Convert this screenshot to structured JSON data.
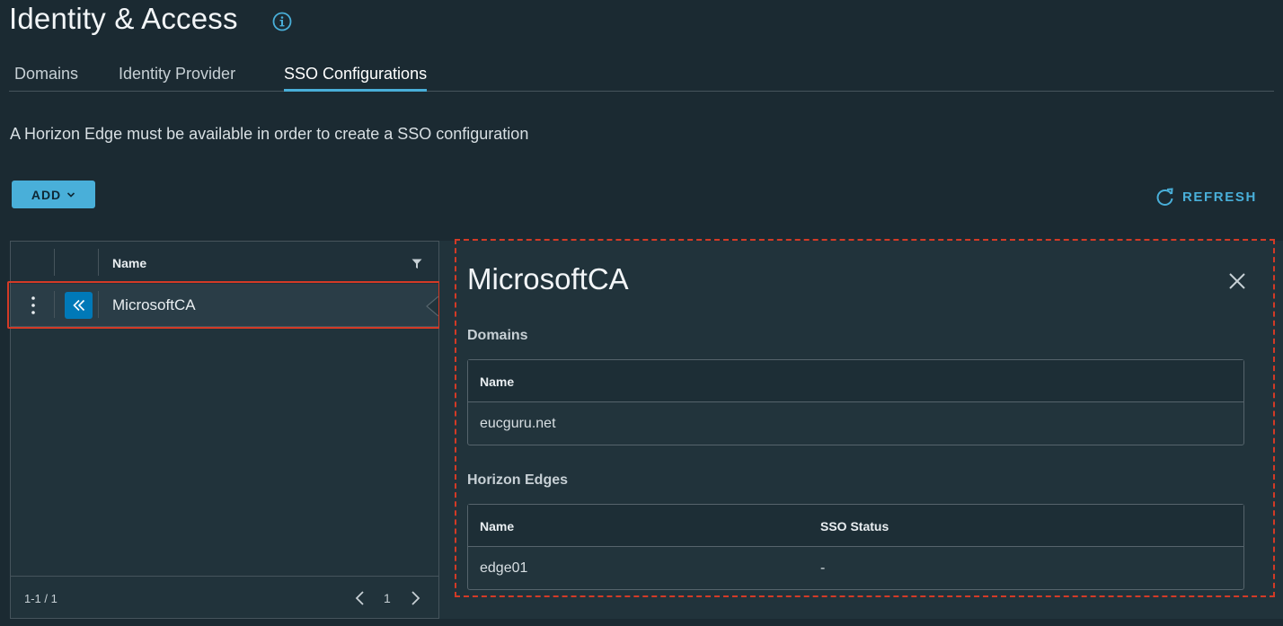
{
  "header": {
    "title": "Identity & Access",
    "info_icon": "info-circle-icon"
  },
  "tabs": [
    {
      "label": "Domains",
      "active": false
    },
    {
      "label": "Identity Provider",
      "active": false
    },
    {
      "label": "SSO Configurations",
      "active": true
    }
  ],
  "notice": "A Horizon Edge must be available in order to create a SSO configuration",
  "toolbar": {
    "add_label": "ADD",
    "refresh_label": "REFRESH"
  },
  "grid": {
    "column_header": "Name",
    "rows": [
      {
        "name": "MicrosoftCA",
        "selected": true
      }
    ],
    "footer": {
      "count": "1-1 / 1",
      "page": "1"
    }
  },
  "detail": {
    "title": "MicrosoftCA",
    "domains": {
      "heading": "Domains",
      "columns": [
        "Name"
      ],
      "rows": [
        [
          "eucguru.net"
        ]
      ]
    },
    "horizon_edges": {
      "heading": "Horizon Edges",
      "columns": [
        "Name",
        "SSO Status"
      ],
      "rows": [
        [
          "edge01",
          "-"
        ]
      ]
    }
  },
  "colors": {
    "background": "#1b2a32",
    "accent": "#49afd9",
    "highlight": "#d33a26"
  }
}
